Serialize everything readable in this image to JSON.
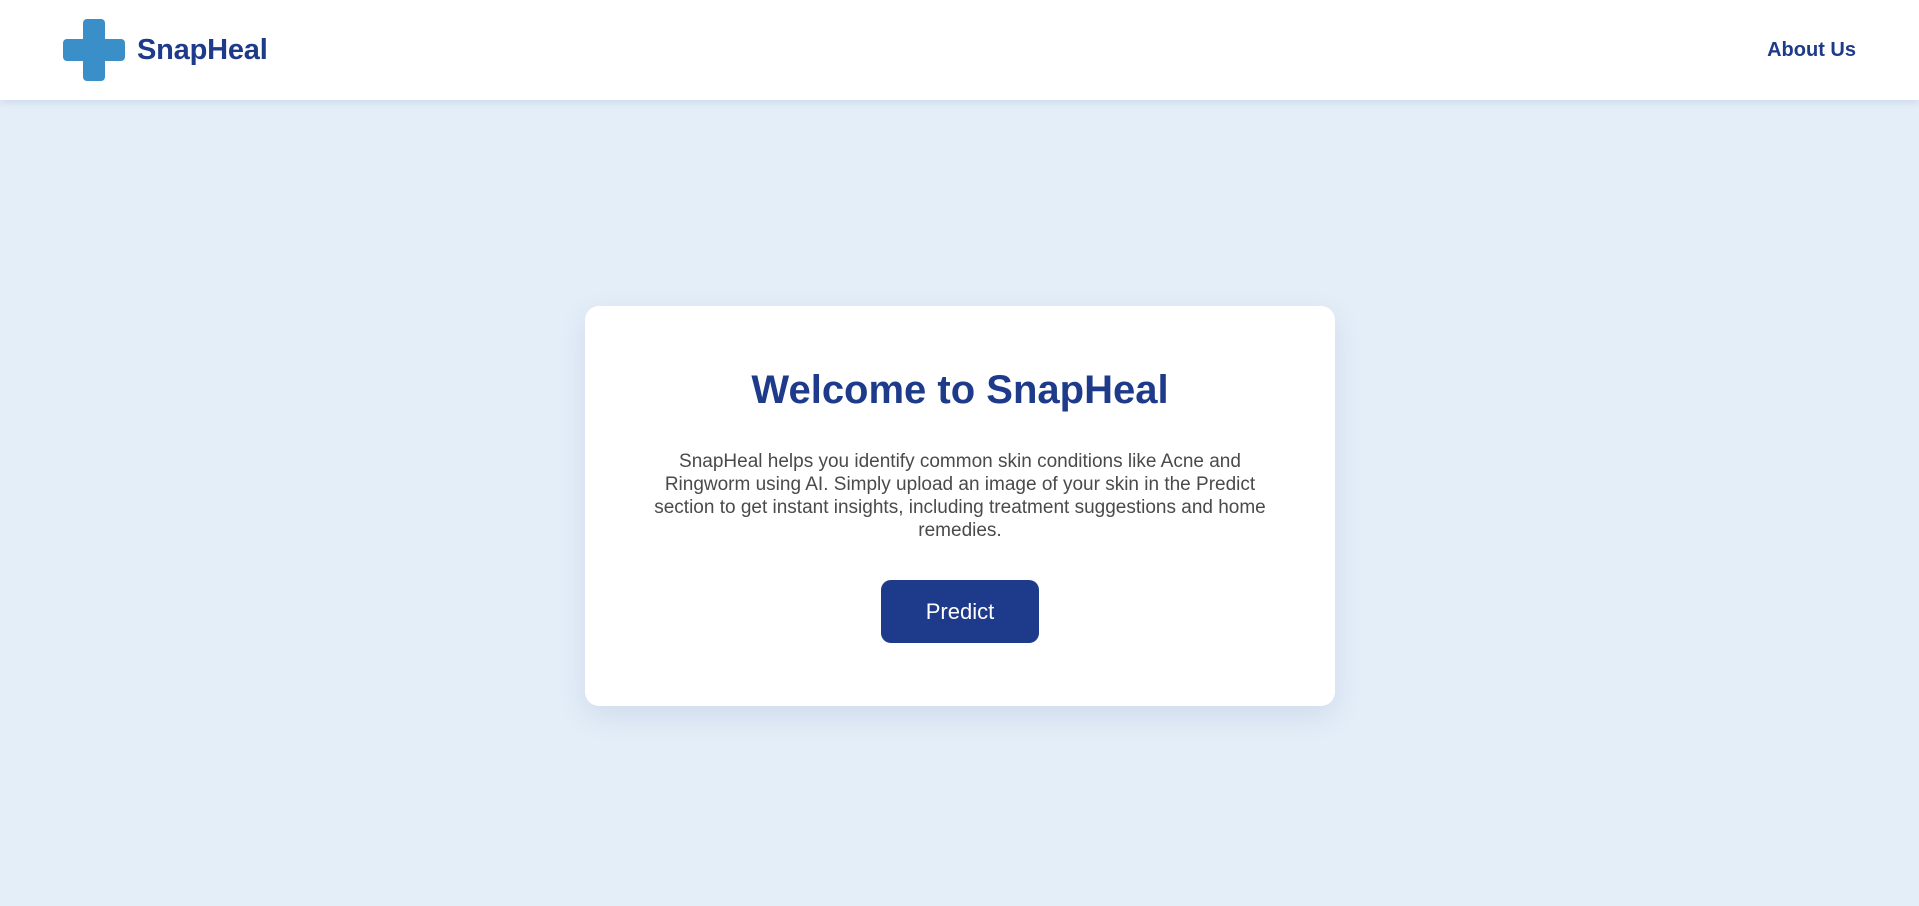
{
  "header": {
    "brand_name": "SnapHeal",
    "logo_icon": "medical-cross-icon",
    "nav_links": [
      {
        "label": "About Us"
      }
    ]
  },
  "main": {
    "title": "Welcome to SnapHeal",
    "description": "SnapHeal helps you identify common skin conditions like Acne and Ringworm using AI. Simply upload an image of your skin in the Predict section to get instant insights, including treatment suggestions and home remedies.",
    "cta_label": "Predict"
  },
  "colors": {
    "background": "#e4eef8",
    "primary": "#1e3a8a",
    "logo": "#3b8fc9",
    "surface": "#ffffff",
    "body_text": "#4a4a4a"
  }
}
